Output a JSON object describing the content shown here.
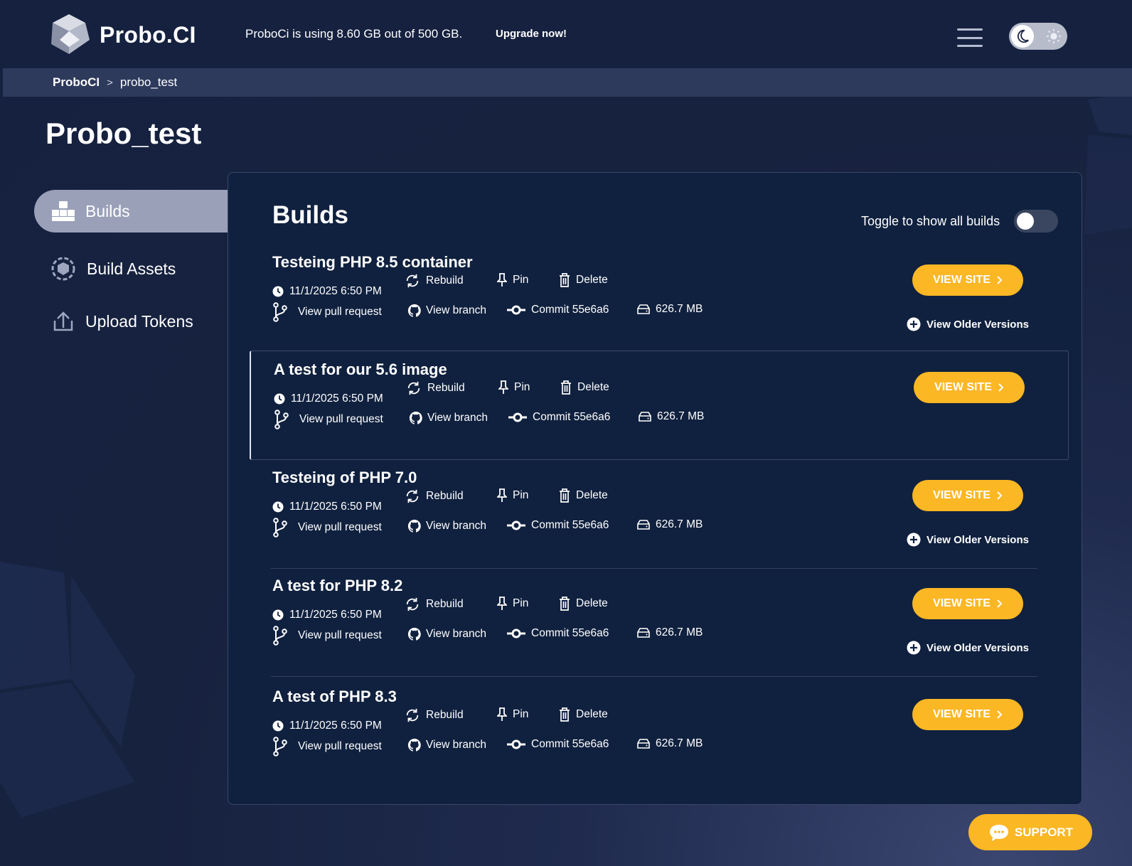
{
  "colors": {
    "accent": "#fbb724",
    "background": "#16213f",
    "panel": "#10213f"
  },
  "header": {
    "logo_text": "Probo.CI",
    "usage_text": "ProboCi is using 8.60 GB out of 500 GB.",
    "upgrade_label": "Upgrade now!",
    "menu_icon": "hamburger-icon",
    "theme_icons": [
      "moon-icon",
      "sun-icon"
    ]
  },
  "breadcrumb": {
    "root": "ProboCI",
    "separator": ">",
    "current": "probo_test"
  },
  "page_title": "Probo_test",
  "sidebar": {
    "items": [
      {
        "label": "Builds",
        "icon": "boxes-icon",
        "active": true
      },
      {
        "label": "Build Assets",
        "icon": "gear-cube-icon",
        "active": false
      },
      {
        "label": "Upload Tokens",
        "icon": "upload-icon",
        "active": false
      }
    ]
  },
  "builds_panel": {
    "title": "Builds",
    "toggle_label": "Toggle to show all builds",
    "toggle_on": false,
    "labels": {
      "rebuild": "Rebuild",
      "pin": "Pin",
      "delete": "Delete",
      "pull_request": "View pull request",
      "branch": "View branch",
      "view_site": "VIEW SITE",
      "older_versions": "View Older Versions"
    },
    "builds": [
      {
        "title": "Testeing PHP 8.5 container",
        "date": "11/1/2025 6:50 PM",
        "commit": "Commit 55e6a6",
        "size": "626.7 MB",
        "has_older": true
      },
      {
        "title": "A test for our 5.6 image",
        "date": "11/1/2025 6:50 PM",
        "commit": "Commit 55e6a6",
        "size": "626.7 MB",
        "has_older": false
      },
      {
        "title": "Testeing of PHP 7.0",
        "date": "11/1/2025 6:50 PM",
        "commit": "Commit 55e6a6",
        "size": "626.7 MB",
        "has_older": true
      },
      {
        "title": "A test for PHP 8.2",
        "date": "11/1/2025 6:50 PM",
        "commit": "Commit 55e6a6",
        "size": "626.7 MB",
        "has_older": true
      },
      {
        "title": "A test of PHP 8.3",
        "date": "11/1/2025 6:50 PM",
        "commit": "Commit 55e6a6",
        "size": "626.7 MB",
        "has_older": false
      }
    ]
  },
  "support_label": "SUPPORT"
}
